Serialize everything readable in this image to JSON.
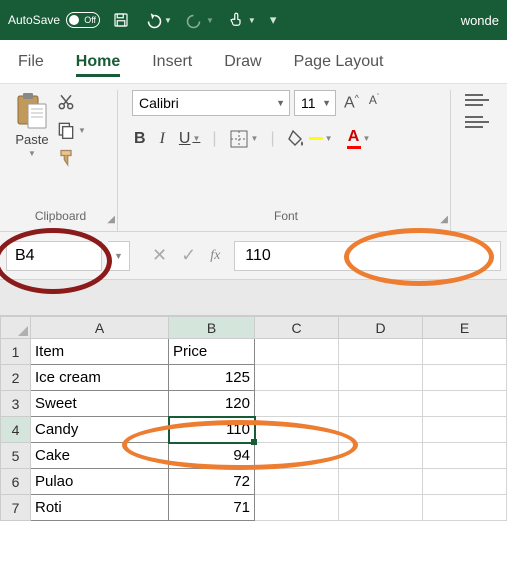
{
  "titlebar": {
    "autosave_label": "AutoSave",
    "autosave_state": "Off",
    "filename": "wonde"
  },
  "tabs": [
    "File",
    "Home",
    "Insert",
    "Draw",
    "Page Layout"
  ],
  "active_tab": 1,
  "ribbon": {
    "clipboard": {
      "paste": "Paste",
      "label": "Clipboard"
    },
    "font": {
      "name": "Calibri",
      "size": "11",
      "label": "Font",
      "fill_color": "#ffff00",
      "text_color": "#ff0000"
    }
  },
  "namebox": {
    "ref": "B4"
  },
  "formula_bar": {
    "value": "110",
    "fx": "fx"
  },
  "columns": [
    "A",
    "B",
    "C",
    "D",
    "E"
  ],
  "active_col": 1,
  "active_row": 3,
  "rows": [
    {
      "n": "1",
      "a": "Item",
      "b": "Price",
      "b_is_text": true
    },
    {
      "n": "2",
      "a": "Ice cream",
      "b": "125"
    },
    {
      "n": "3",
      "a": "Sweet",
      "b": "120"
    },
    {
      "n": "4",
      "a": "Candy",
      "b": "110",
      "selected": true
    },
    {
      "n": "5",
      "a": "Cake",
      "b": "94"
    },
    {
      "n": "6",
      "a": "Pulao",
      "b": "72"
    },
    {
      "n": "7",
      "a": "Roti",
      "b": "71"
    }
  ],
  "annotations": {
    "namebox_circle": {
      "color": "red"
    },
    "formula_circle": {
      "color": "orange"
    },
    "cell_circle": {
      "color": "orange"
    }
  }
}
